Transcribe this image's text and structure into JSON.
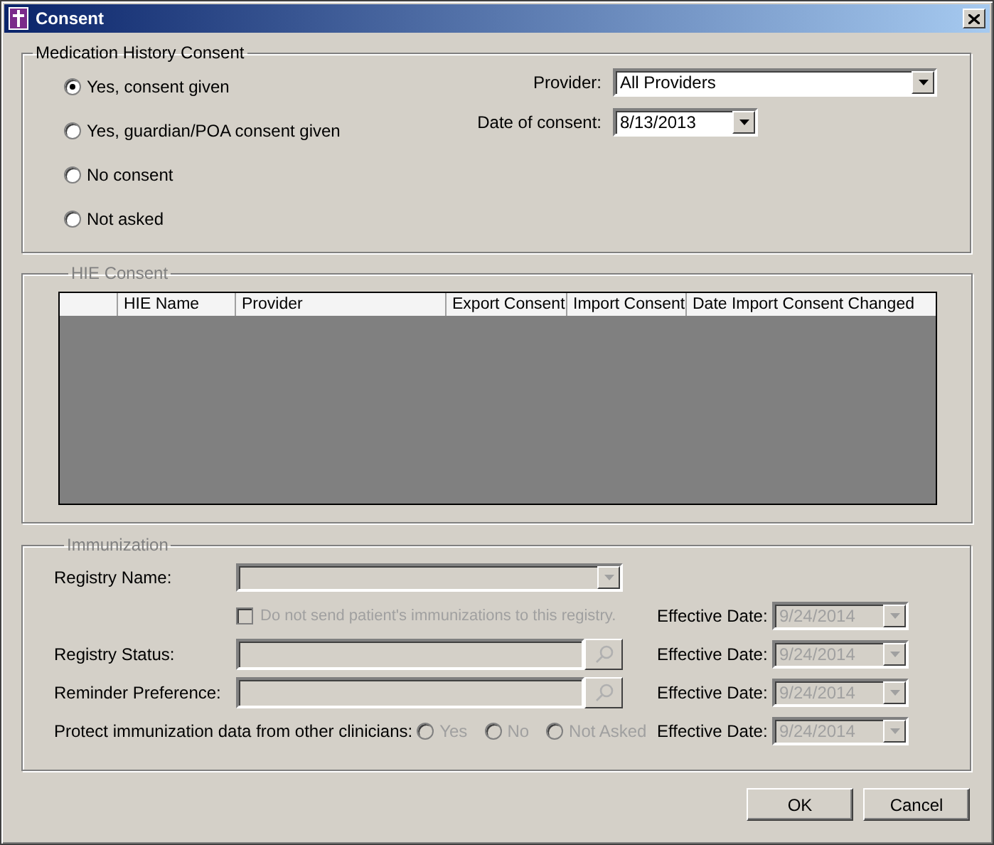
{
  "window": {
    "title": "Consent"
  },
  "medication_history": {
    "title": "Medication History Consent",
    "options": [
      {
        "label": "Yes, consent given",
        "selected": true
      },
      {
        "label": "Yes, guardian/POA consent given",
        "selected": false
      },
      {
        "label": "No consent",
        "selected": false
      },
      {
        "label": "Not asked",
        "selected": false
      }
    ],
    "provider": {
      "label": "Provider:",
      "value": "All Providers"
    },
    "date": {
      "label": "Date of consent:",
      "value": "8/13/2013"
    }
  },
  "hie": {
    "title": "HIE Consent",
    "table": {
      "columns": [
        "HIE Name",
        "Provider",
        "Export Consent",
        "Import Consent",
        "Date Import Consent Changed"
      ]
    }
  },
  "immunization": {
    "title": "Immunization",
    "disabled": true,
    "rows": [
      {
        "kind": "combo",
        "label": "Registry Name:"
      },
      {
        "kind": "checkbox",
        "label": "Do not send patient's immunizations to this registry.",
        "checked": false,
        "effective_label": "Effective Date:",
        "effective_date": "9/24/2014"
      },
      {
        "kind": "lookup",
        "label": "Registry Status:",
        "effective_label": "Effective Date:",
        "effective_date": "9/24/2014"
      },
      {
        "kind": "lookup",
        "label": "Reminder Preference:",
        "effective_label": "Effective Date:",
        "effective_date": "9/24/2014"
      },
      {
        "kind": "radios",
        "label": "Protect immunization data from other clinicians:",
        "options": [
          {
            "label": "Yes",
            "selected": false
          },
          {
            "label": "No",
            "selected": false
          },
          {
            "label": "Not Asked",
            "selected": false
          }
        ],
        "effective_label": "Effective Date:",
        "effective_date": "9/24/2014"
      }
    ]
  },
  "buttons": [
    "OK",
    "Cancel"
  ]
}
